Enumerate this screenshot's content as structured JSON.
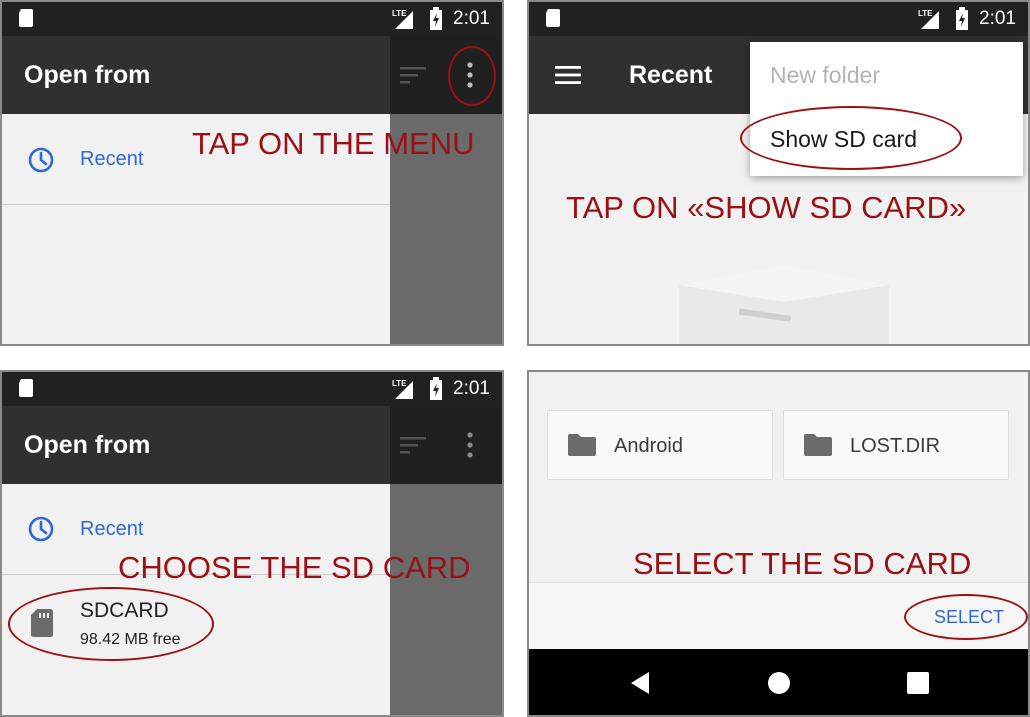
{
  "status": {
    "network": "LTE",
    "time": "2:01"
  },
  "panel1": {
    "title": "Open from",
    "drawer_items": [
      {
        "label": "Recent"
      }
    ],
    "annotation": "TAP ON THE MENU"
  },
  "panel2": {
    "title": "Recent",
    "menu_items": [
      {
        "label": "New folder"
      },
      {
        "label": "Show SD card"
      }
    ],
    "annotation": "TAP ON «SHOW SD CARD»"
  },
  "panel3": {
    "title": "Open from",
    "drawer_items": [
      {
        "label": "Recent"
      }
    ],
    "sdcard": {
      "name": "SDCARD",
      "free": "98.42 MB free"
    },
    "annotation": "CHOOSE THE SD CARD"
  },
  "panel4": {
    "folders": [
      {
        "name": "Android"
      },
      {
        "name": "LOST.DIR"
      }
    ],
    "select_label": "SELECT",
    "annotation": "SELECT THE SD CARD"
  },
  "colors": {
    "annotation": "#9b1014",
    "status_bar": "#212121",
    "app_bar": "#303030",
    "accent_blue": "#3067d6",
    "scrim": "#6a6a6a"
  },
  "icons": [
    "sd-card-icon",
    "lte-signal-icon",
    "battery-charging-icon",
    "sort-icon",
    "overflow-menu-icon",
    "hamburger-menu-icon",
    "clock-icon",
    "folder-icon",
    "back-icon",
    "home-icon",
    "recents-icon"
  ]
}
